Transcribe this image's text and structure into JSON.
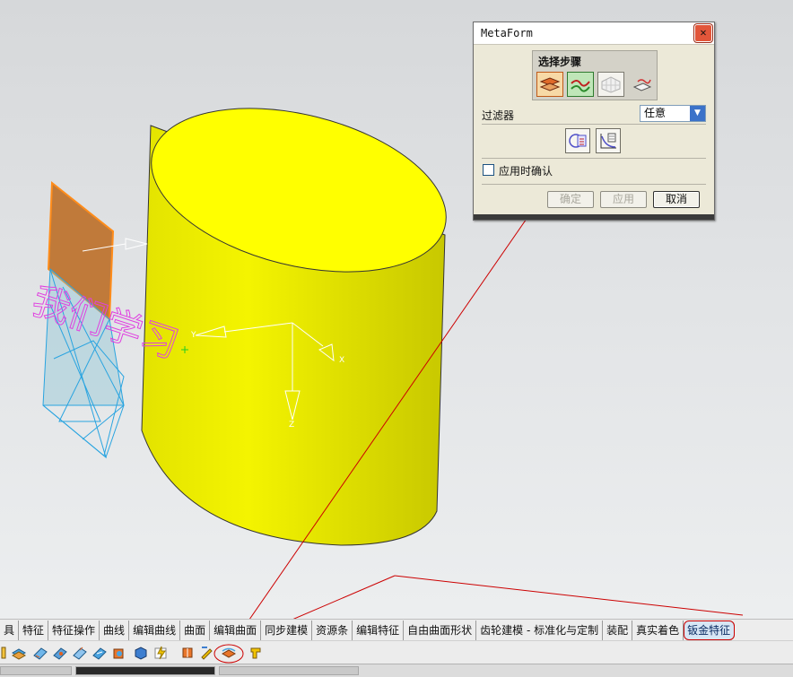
{
  "dialog": {
    "title": "MetaForm",
    "close_glyph": "✕",
    "steps_label": "选择步骤",
    "step_icons": [
      "sheet-select-icon",
      "target-surface-icon",
      "surface-mesh-icon",
      "flatten-sheet-icon"
    ],
    "filter_label": "过滤器",
    "filter_value": "任意",
    "filter_arrow": "▼",
    "mode_icons": [
      "feature-blend-icon",
      "curve-chart-icon"
    ],
    "apply_confirm_label": "应用时确认",
    "buttons": {
      "ok": "确定",
      "apply": "应用",
      "cancel": "取消"
    }
  },
  "viewport": {
    "solid_color": "#f7f700",
    "sheet_color": "#c07a3a",
    "text_graphic": "我们学习",
    "axis_labels": {
      "x": "X",
      "y": "Y",
      "z": "Z"
    }
  },
  "tabbar": {
    "tabs": [
      "具",
      "特征",
      "特征操作",
      "曲线",
      "编辑曲线",
      "曲面",
      "编辑曲面",
      "同步建模",
      "资源条",
      "编辑特征",
      "自由曲面形状",
      "齿轮建模 - 标准化与定制",
      "装配",
      "真实着色",
      "钣金特征"
    ],
    "active_tab": "钣金特征"
  },
  "toolbar": {
    "icons": [
      "sheet-open-icon",
      "sheet-blue-icon",
      "bend-icon",
      "flange-icon",
      "tab-icon",
      "punch-icon",
      "cube-icon",
      "lightning-icon",
      "solid-split-icon",
      "edit-icon",
      "metaform-icon",
      "pipe-icon"
    ]
  },
  "colors": {
    "annotation_red": "#cc0000",
    "accent_blue": "#3b72c9"
  }
}
